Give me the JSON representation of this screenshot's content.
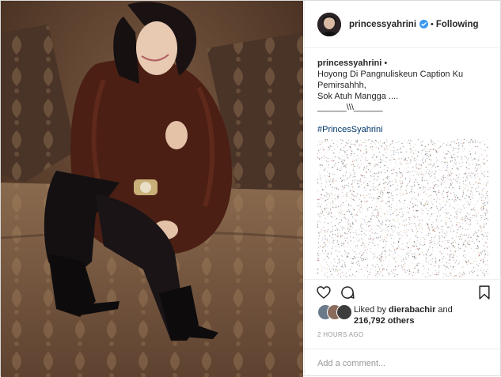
{
  "post": {
    "username": "princessyahrini",
    "follow_label": "Following",
    "dot": "•",
    "caption_user": "princessyahrini",
    "caption_lines": [
      "Hoyong Di Pangnuliskeun Caption Ku",
      "Pemirsahhh,",
      "Sok Atuh Mangga ....",
      "______\\\\\\______"
    ],
    "hashtag": "#PrincesSyahrini",
    "likes_prefix": "Liked by",
    "likes_user": "dierabachir",
    "likes_mid": "and",
    "likes_count": "216,792 others",
    "time": "2 HOURS AGO",
    "comment_placeholder": "Add a comment..."
  },
  "colors": {
    "border": "#dbdbdb",
    "text": "#262626",
    "muted": "#999999",
    "link": "#003569",
    "verified": "#3897f0"
  },
  "icons": {
    "like": "heart-icon",
    "comment": "comment-icon",
    "share": "share-icon",
    "save": "bookmark-icon",
    "verified": "verified-badge-icon"
  }
}
